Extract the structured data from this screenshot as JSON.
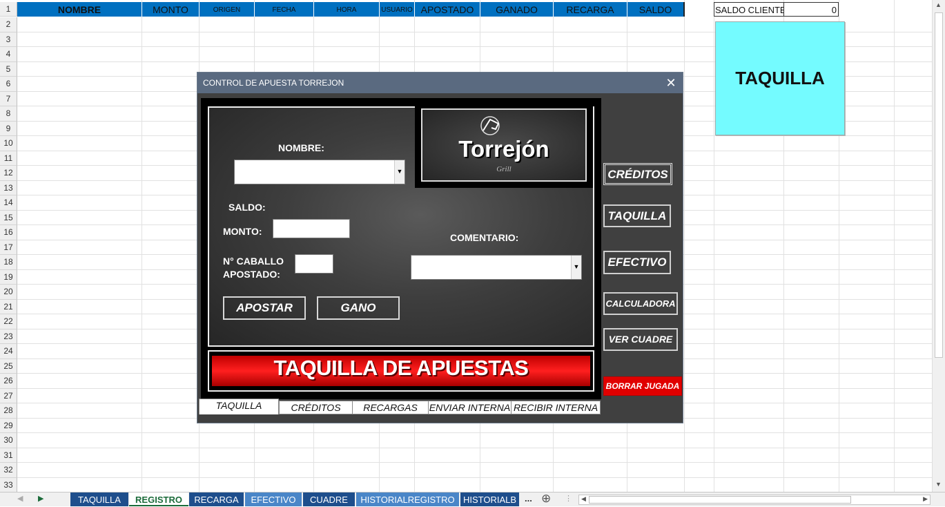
{
  "header": {
    "row1_number": "1",
    "columns": [
      {
        "label": "NOMBRE"
      },
      {
        "label": "MONTO"
      },
      {
        "label": "ORIGEN"
      },
      {
        "label": "FECHA"
      },
      {
        "label": "HORA"
      },
      {
        "label": "USUARIO"
      },
      {
        "label": "APOSTADO"
      },
      {
        "label": "GANADO"
      },
      {
        "label": "RECARGA"
      },
      {
        "label": "SALDO"
      }
    ],
    "saldo_clientes_label": "SALDO CLIENTES",
    "saldo_clientes_value": "0"
  },
  "row_numbers": [
    "2",
    "3",
    "4",
    "5",
    "6",
    "7",
    "8",
    "9",
    "10",
    "11",
    "12",
    "13",
    "14",
    "15",
    "16",
    "17",
    "18",
    "19",
    "20",
    "21",
    "22",
    "23",
    "24",
    "25",
    "26",
    "27",
    "28",
    "29",
    "30",
    "31",
    "32",
    "33"
  ],
  "taquilla_shape_label": "TAQUILLA",
  "dialog": {
    "title": "CONTROL DE APUESTA TORREJON",
    "close_glyph": "✕",
    "logo_text": "Torrejón",
    "logo_subtext": "Grill",
    "nombre_label": "NOMBRE:",
    "saldo_label": "SALDO:",
    "monto_label": "MONTO:",
    "caballo_label_line1": "N° CABALLO",
    "caballo_label_line2": "APOSTADO:",
    "comentario_label": "COMENTARIO:",
    "apostar_button": "APOSTAR",
    "gano_button": "GANO",
    "banner_text": "TAQUILLA DE APUESTAS",
    "side_buttons": {
      "creditos": "CRÉDITOS",
      "taquilla": "TAQUILLA",
      "efectivo": "EFECTIVO",
      "calculadora": "CALCULADORA",
      "ver_cuadre": "VER CUADRE",
      "borrar_jugada": "BORRAR JUGADA"
    },
    "tabs": [
      "TAQUILLA",
      "CRÉDITOS",
      "RECARGAS",
      "ENVIAR INTERNA",
      "RECIBIR INTERNA"
    ],
    "active_tab": "TAQUILLA"
  },
  "sheet_tabs": [
    "TAQUILLA",
    "REGISTRO",
    "RECARGA",
    "EFECTIVO",
    "CUADRE",
    "HISTORIALREGISTRO",
    "HISTORIALB"
  ],
  "active_sheet": "REGISTRO",
  "sheet_tabs_more": "...",
  "add_sheet_glyph": "⊕",
  "colors": {
    "header_fill": "#0070c0",
    "taquilla_shape": "#74fbff",
    "dialog_bg": "#404040",
    "borrar_red": "#e00000"
  }
}
